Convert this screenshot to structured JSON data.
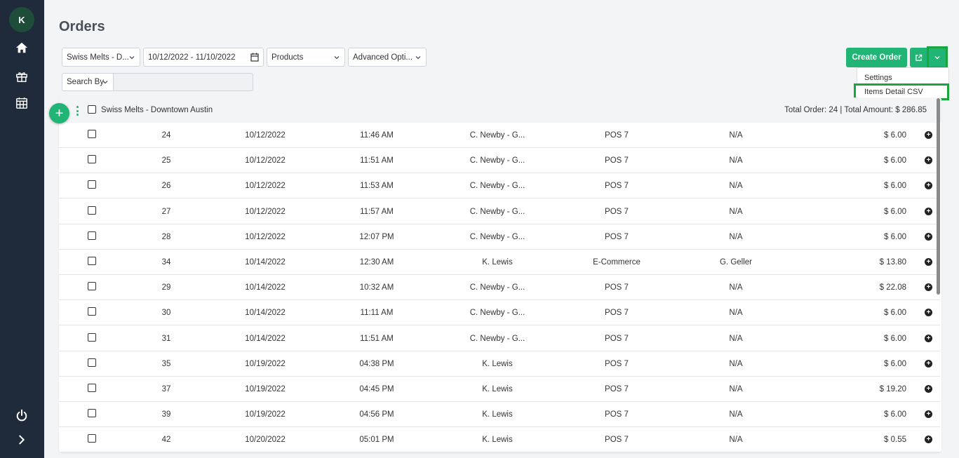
{
  "sidebar": {
    "avatar_initial": "K",
    "icons": [
      "home-icon",
      "gift-icon",
      "calendar-grid-icon",
      "power-icon",
      "chevron-right-icon"
    ]
  },
  "page": {
    "title": "Orders"
  },
  "filters": {
    "location": "Swiss Melts - D...",
    "date_range": "10/12/2022 - 11/10/2022",
    "products": "Products",
    "advanced": "Advanced Opti...",
    "search_by": "Search By",
    "search_value": ""
  },
  "actions": {
    "create_order": "Create Order",
    "menu_items": [
      "Settings",
      "Items Detail CSV"
    ]
  },
  "group": {
    "name": "Swiss Melts - Downtown Austin",
    "total": "Total Order: 24 | Total Amount: $ 286.85"
  },
  "orders": [
    {
      "num": "24",
      "date": "10/12/2022",
      "time": "11:46 AM",
      "customer": "C. Newby - G...",
      "source": "POS 7",
      "employee": "N/A",
      "amount": "$ 6.00"
    },
    {
      "num": "25",
      "date": "10/12/2022",
      "time": "11:51 AM",
      "customer": "C. Newby - G...",
      "source": "POS 7",
      "employee": "N/A",
      "amount": "$ 6.00"
    },
    {
      "num": "26",
      "date": "10/12/2022",
      "time": "11:53 AM",
      "customer": "C. Newby - G...",
      "source": "POS 7",
      "employee": "N/A",
      "amount": "$ 6.00"
    },
    {
      "num": "27",
      "date": "10/12/2022",
      "time": "11:57 AM",
      "customer": "C. Newby - G...",
      "source": "POS 7",
      "employee": "N/A",
      "amount": "$ 6.00"
    },
    {
      "num": "28",
      "date": "10/12/2022",
      "time": "12:07 PM",
      "customer": "C. Newby - G...",
      "source": "POS 7",
      "employee": "N/A",
      "amount": "$ 6.00"
    },
    {
      "num": "34",
      "date": "10/14/2022",
      "time": "12:30 AM",
      "customer": "K. Lewis",
      "source": "E-Commerce",
      "employee": "G. Geller",
      "amount": "$ 13.80"
    },
    {
      "num": "29",
      "date": "10/14/2022",
      "time": "10:32 AM",
      "customer": "C. Newby - G...",
      "source": "POS 7",
      "employee": "N/A",
      "amount": "$ 22.08"
    },
    {
      "num": "30",
      "date": "10/14/2022",
      "time": "11:11 AM",
      "customer": "C. Newby - G...",
      "source": "POS 7",
      "employee": "N/A",
      "amount": "$ 6.00"
    },
    {
      "num": "31",
      "date": "10/14/2022",
      "time": "11:51 AM",
      "customer": "C. Newby - G...",
      "source": "POS 7",
      "employee": "N/A",
      "amount": "$ 6.00"
    },
    {
      "num": "35",
      "date": "10/19/2022",
      "time": "04:38 PM",
      "customer": "K. Lewis",
      "source": "POS 7",
      "employee": "N/A",
      "amount": "$ 6.00"
    },
    {
      "num": "37",
      "date": "10/19/2022",
      "time": "04:45 PM",
      "customer": "K. Lewis",
      "source": "POS 7",
      "employee": "N/A",
      "amount": "$ 19.20"
    },
    {
      "num": "39",
      "date": "10/19/2022",
      "time": "04:56 PM",
      "customer": "K. Lewis",
      "source": "POS 7",
      "employee": "N/A",
      "amount": "$ 6.00"
    },
    {
      "num": "42",
      "date": "10/20/2022",
      "time": "05:01 PM",
      "customer": "K. Lewis",
      "source": "POS 7",
      "employee": "N/A",
      "amount": "$ 0.55"
    }
  ],
  "colors": {
    "sidebar": "#1f2a3a",
    "accent": "#20b574",
    "highlight": "#1aa63c"
  }
}
